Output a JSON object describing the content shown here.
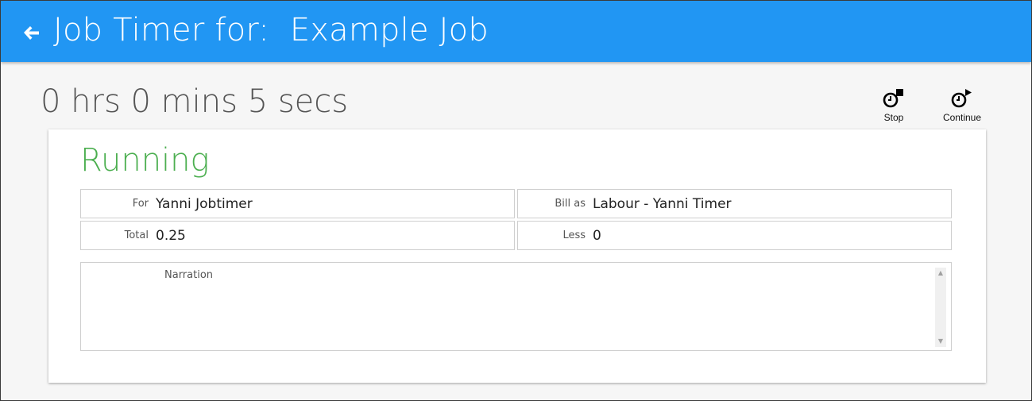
{
  "header": {
    "title": "Job Timer for:  Example Job",
    "back_icon": "arrow-left-icon",
    "color": "#2196f3"
  },
  "timer": {
    "elapsed": "0 hrs 0 mins 5 secs"
  },
  "actions": {
    "stop_label": "Stop",
    "stop_icon": "clock-stop-icon",
    "continue_label": "Continue",
    "continue_icon": "clock-play-icon"
  },
  "card": {
    "status": "Running",
    "status_color": "#4caf50",
    "fields": {
      "for_label": "For",
      "for_value": "Yanni Jobtimer",
      "bill_as_label": "Bill as",
      "bill_as_value": "Labour - Yanni Timer",
      "total_label": "Total",
      "total_value": "0.25",
      "less_label": "Less",
      "less_value": "0"
    },
    "narration": {
      "label": "Narration",
      "value": ""
    }
  }
}
